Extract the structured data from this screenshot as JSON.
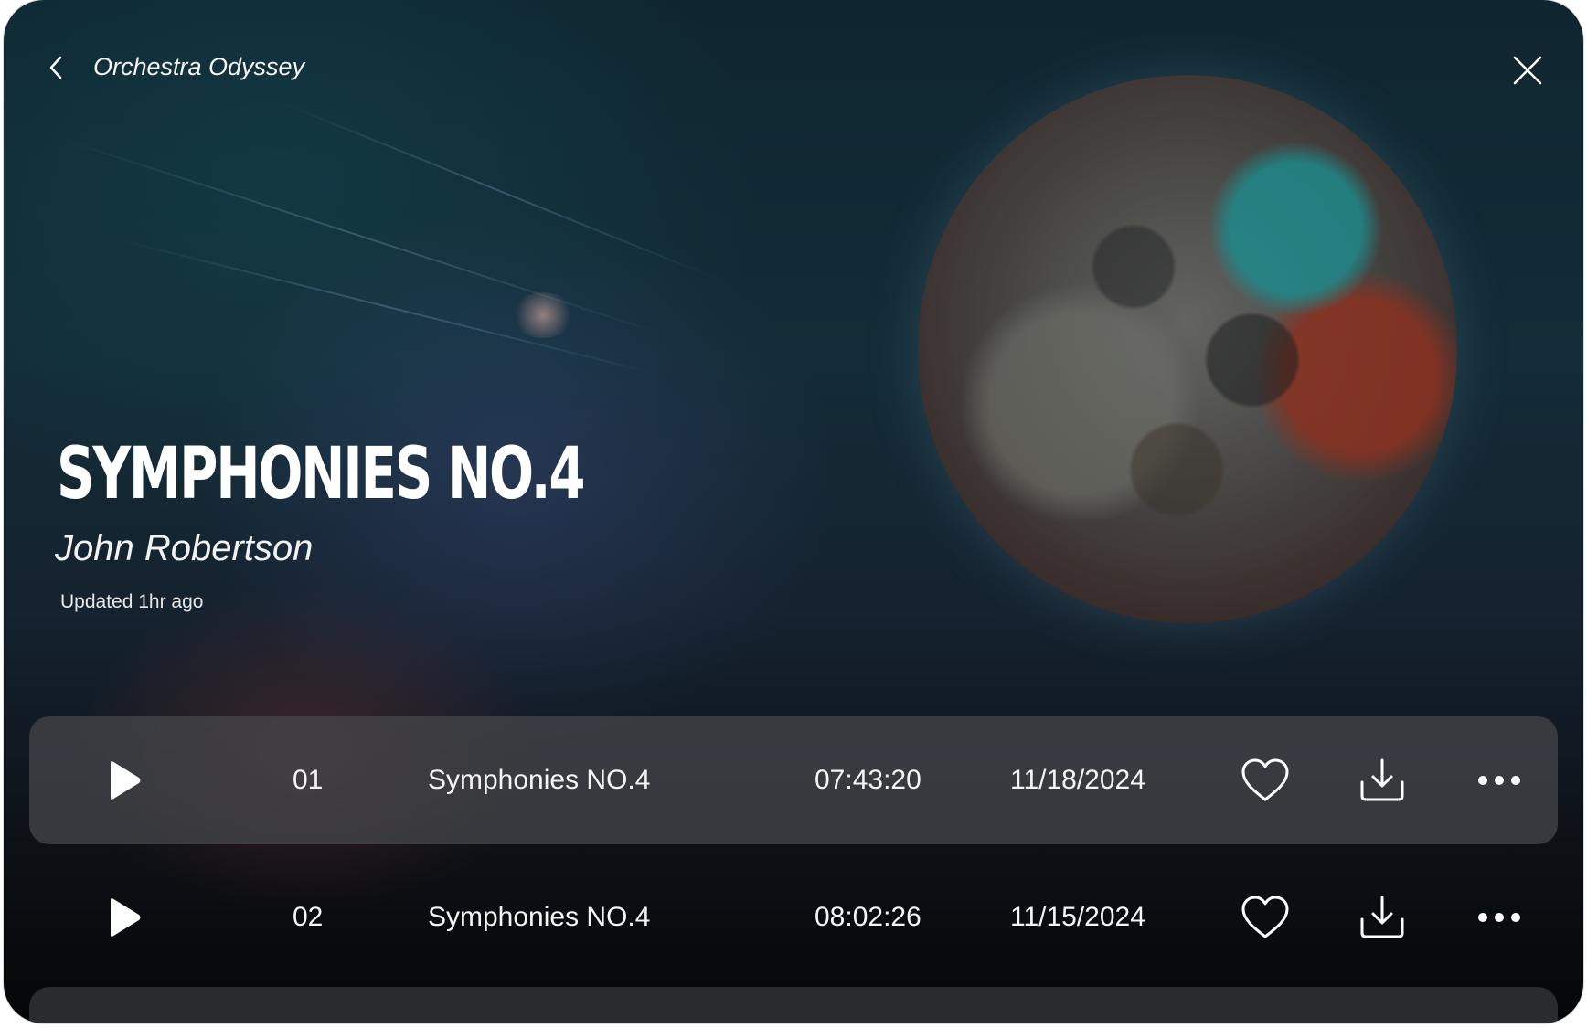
{
  "header": {
    "back_icon": "chevron-left-icon",
    "title": "Orchestra Odyssey",
    "close_icon": "close-icon"
  },
  "hero": {
    "album_title": "SYMPHONIES NO.4",
    "artist": "John Robertson",
    "updated": "Updated 1hr ago"
  },
  "tracks": [
    {
      "number": "01",
      "title": "Symphonies NO.4",
      "duration": "07:43:20",
      "date": "11/18/2024",
      "active": true
    },
    {
      "number": "02",
      "title": "Symphonies NO.4",
      "duration": "08:02:26",
      "date": "11/15/2024",
      "active": false
    }
  ],
  "row_icons": {
    "play": "play-icon",
    "favorite": "heart-icon",
    "download": "download-icon",
    "more": "more-horizontal-icon"
  },
  "colors": {
    "text": "#ffffff",
    "active_row": "#46484c",
    "peek_row": "#2a2b2d"
  }
}
